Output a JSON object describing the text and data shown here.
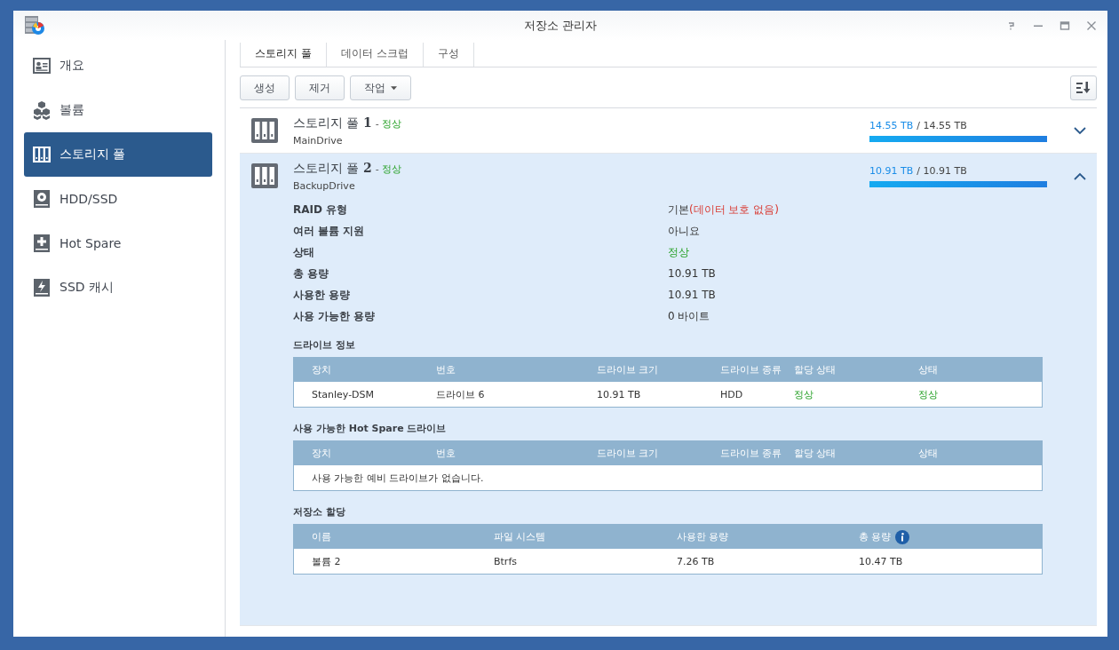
{
  "window": {
    "title": "저장소 관리자"
  },
  "sidebar": {
    "items": [
      {
        "label": "개요",
        "selected": false
      },
      {
        "label": "볼륨",
        "selected": false
      },
      {
        "label": "스토리지 풀",
        "selected": true
      },
      {
        "label": "HDD/SSD",
        "selected": false
      },
      {
        "label": "Hot Spare",
        "selected": false
      },
      {
        "label": "SSD 캐시",
        "selected": false
      }
    ]
  },
  "tabs": [
    {
      "label": "스토리지 풀",
      "selected": true
    },
    {
      "label": "데이터 스크럽",
      "selected": false
    },
    {
      "label": "구성",
      "selected": false
    }
  ],
  "toolbar": {
    "buttons": [
      {
        "label": "생성",
        "kind": "plain"
      },
      {
        "label": "제거",
        "kind": "plain"
      },
      {
        "label": "작업",
        "kind": "dropdown"
      }
    ]
  },
  "pools": [
    {
      "name": "스토리지 풀",
      "number": "1",
      "separator": "-",
      "status": "정상",
      "description": "MainDrive",
      "used": "14.55 TB",
      "total": "/ 14.55 TB",
      "level": 1,
      "expanded": false
    },
    {
      "name": "스토리지 풀",
      "number": "2",
      "separator": "-",
      "status": "정상",
      "description": "BackupDrive",
      "used": "10.91 TB",
      "total": "/ 10.91 TB",
      "level": 1,
      "expanded": true,
      "details": [
        {
          "label": "RAID 유형",
          "value": "기본",
          "note": "(데이터 보호 없음)",
          "kind": "text"
        },
        {
          "label": "여러 볼륨 지원",
          "value": "아니요",
          "kind": "text"
        },
        {
          "label": "상태",
          "value": "정상",
          "kind": "status"
        },
        {
          "label": "총 용량",
          "value": "10.91 TB",
          "kind": "text"
        },
        {
          "label": "사용한 용량",
          "value": "10.91 TB",
          "kind": "text"
        },
        {
          "label": "사용 가능한 용량",
          "value": "0 바이트",
          "kind": "text"
        }
      ],
      "sections": [
        {
          "title": "드라이브 정보",
          "kind": "drives",
          "columns": [
            "장치",
            "번호",
            "드라이브 크기",
            "드라이브 종류",
            "할당 상태",
            "상태"
          ],
          "rows": [
            [
              {
                "text": "Stanley-DSM",
                "kind": "text"
              },
              {
                "text": "드라이브 6",
                "kind": "text"
              },
              {
                "text": "10.91 TB",
                "kind": "text"
              },
              {
                "text": "HDD",
                "kind": "text"
              },
              {
                "text": "정상",
                "kind": "status"
              },
              {
                "text": "정상",
                "kind": "status"
              }
            ]
          ]
        },
        {
          "title": "사용 가능한 **Hot Spare** 드라이브",
          "kind": "drives",
          "columns": [
            "장치",
            "번호",
            "드라이브 크기",
            "드라이브 종류",
            "할당 상태",
            "상태"
          ],
          "empty": "사용 가능한 예비 드라이브가 없습니다."
        },
        {
          "title": "저장소 할당",
          "kind": "allocation",
          "columns": [
            "이름",
            "파일 시스템",
            "사용한 용량",
            "총 용량"
          ],
          "rows": [
            [
              {
                "text": "볼륨 2",
                "kind": "text"
              },
              {
                "text": "Btrfs",
                "kind": "text"
              },
              {
                "text": "7.26 TB",
                "kind": "text"
              },
              {
                "text": "10.47 TB",
                "kind": "text"
              }
            ]
          ]
        }
      ]
    }
  ]
}
